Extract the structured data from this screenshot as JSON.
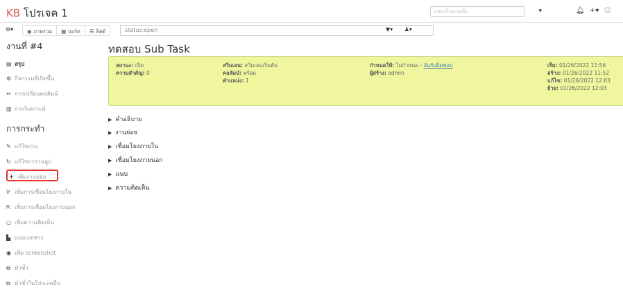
{
  "header": {
    "brand": "KB",
    "project": "โปรเจค 1",
    "project_select_placeholder": "แสดงโปรเจคอื่น",
    "icons": [
      "bell-icon",
      "plus-icon",
      "avatar-icon"
    ]
  },
  "filterbar": {
    "views": [
      "ภาพรวม",
      "บอร์ด",
      "ลิสต์"
    ],
    "search_value": "status:open"
  },
  "sidebar": {
    "task_title": "งานที่ #4",
    "info_items": [
      {
        "icon": "▤",
        "label": "สรุป",
        "bold": true
      },
      {
        "icon": "⚙",
        "label": "กิจกรรมที่เกิดขึ้น"
      },
      {
        "icon": "↔",
        "label": "การเปลี่ยนคอลัมน์"
      },
      {
        "icon": "▥",
        "label": "การวิเคราะห์"
      }
    ],
    "actions_title": "การกระทำ",
    "actions": [
      {
        "icon": "✎",
        "label": "แก้ไขงาน"
      },
      {
        "icon": "↻",
        "label": "แก้ไขการวนลูป"
      },
      {
        "icon": "+",
        "label": "เพิ่มงานย่อย",
        "highlight": true
      },
      {
        "icon": "⅌",
        "label": "เพิ่มการเชื่อมโยงภายใน"
      },
      {
        "icon": "⇱",
        "label": "เพิ่มการเชื่อมโยงภายนอก"
      },
      {
        "icon": "○",
        "label": "เพิ่มความคิดเห็น"
      },
      {
        "icon": "▙",
        "label": "แนบเอกสาร"
      },
      {
        "icon": "◉",
        "label": "เพิ่ม screenshot"
      },
      {
        "icon": "⧉",
        "label": "ทำซ้ำ"
      },
      {
        "icon": "⧉",
        "label": "ทำซ้ำในโปรเจคอื่น"
      }
    ]
  },
  "main": {
    "title": "ทดสอบ Sub Task",
    "summary": {
      "col1": [
        {
          "label": "สถานะ:",
          "value": "เปิด"
        },
        {
          "label": "ความสำคัญ:",
          "value": "0"
        }
      ],
      "col2": [
        {
          "label": "สวิมเลน:",
          "value": "สวิมเลนเริ่มต้น"
        },
        {
          "label": "คอลัมน์:",
          "value": "พร้อม"
        },
        {
          "label": "ตำแหน่ง:",
          "value": "1"
        }
      ],
      "col3": [
        {
          "label": "กำหนดให้:",
          "value": "ไม่กำหนด - ",
          "link": "อันรับผิดชอบ"
        },
        {
          "label": "ผู้สร้าง:",
          "value": "admin"
        }
      ],
      "col4": [
        {
          "label": "เริ่ม:",
          "value": "01/26/2022 11:56"
        },
        {
          "label": "สร้าง:",
          "value": "01/26/2022 11:52"
        },
        {
          "label": "แก้ไข:",
          "value": "01/26/2022 12:03"
        },
        {
          "label": "ย้าย:",
          "value": "01/26/2022 12:03"
        }
      ]
    },
    "sections": [
      "คำอธิบาย",
      "งานย่อย",
      "เชื่อมโยงภายใน",
      "เชื่อมโยงภายนอก",
      "แนบ",
      "ความคิดเห็น"
    ]
  }
}
